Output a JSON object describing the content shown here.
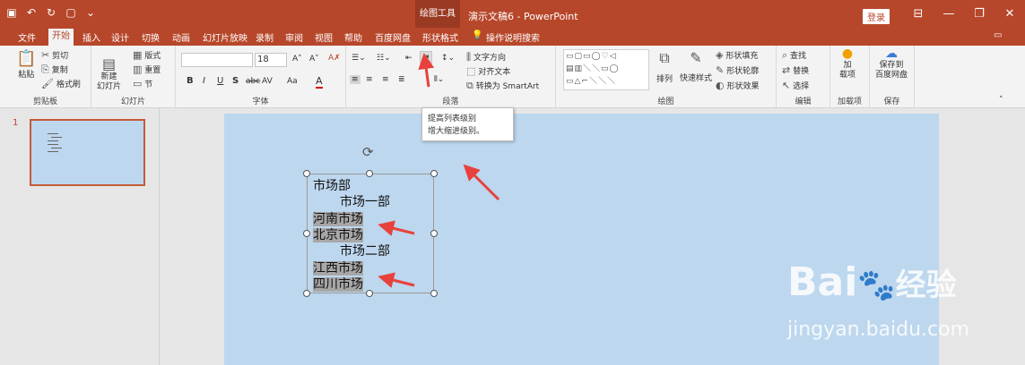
{
  "titlebar": {
    "qat_icons": [
      "save-icon",
      "undo-icon",
      "redo-icon",
      "new-icon",
      "customize-icon"
    ],
    "context_label": "绘图工具",
    "doc_title": "演示文稿6 - PowerPoint",
    "login": "登录",
    "window_buttons": [
      "⊟",
      "—",
      "❐",
      "✕"
    ]
  },
  "tabs": [
    "文件",
    "开始",
    "插入",
    "设计",
    "切换",
    "动画",
    "幻灯片放映",
    "录制",
    "审阅",
    "视图",
    "帮助",
    "百度网盘",
    "形状格式"
  ],
  "tell_me": "操作说明搜索",
  "ribbon": {
    "clipboard": {
      "paste": "粘贴",
      "cut": "剪切",
      "copy": "复制",
      "format_painter": "格式刷",
      "label": "剪贴板"
    },
    "slides": {
      "new_slide": "新建\n幻灯片",
      "layout": "版式",
      "reset": "重置",
      "section": "节",
      "label": "幻灯片"
    },
    "font": {
      "font_name": "",
      "font_size": "18",
      "label": "字体",
      "bold": "B",
      "italic": "I",
      "underline": "U",
      "shadow": "S",
      "strike": "abc",
      "spacing": "AV",
      "case": "Aa",
      "color": "A"
    },
    "paragraph": {
      "text_direction": "文字方向",
      "align_text": "对齐文本",
      "smartart": "转换为 SmartArt",
      "label": "段落"
    },
    "drawing": {
      "arrange": "排列",
      "quick_styles": "快速样式",
      "fill": "形状填充",
      "outline": "形状轮廓",
      "effects": "形状效果",
      "label": "绘图"
    },
    "editing": {
      "find": "查找",
      "replace": "替换",
      "select": "选择",
      "label": "编辑"
    },
    "addins": {
      "label_btn": "加\n载项",
      "label": "加载项"
    },
    "save": {
      "btn": "保存到\n百度网盘",
      "label": "保存"
    }
  },
  "tooltip": {
    "title": "提高列表级别",
    "desc": "增大缩进级别。"
  },
  "sidebar": {
    "slide_number": "1"
  },
  "slide": {
    "lines": [
      {
        "text": "市场部",
        "indent": 0,
        "selected": false
      },
      {
        "text": "市场一部",
        "indent": 1,
        "selected": false
      },
      {
        "text": "河南市场",
        "indent": 0,
        "selected": true
      },
      {
        "text": "北京市场",
        "indent": 0,
        "selected": true
      },
      {
        "text": "市场二部",
        "indent": 1,
        "selected": false
      },
      {
        "text": "江西市场",
        "indent": 0,
        "selected": true
      },
      {
        "text": "四川市场",
        "indent": 0,
        "selected": true
      }
    ]
  },
  "watermark": {
    "logo": "Bai",
    "logo2": "经验",
    "url": "jingyan.baidu.com"
  },
  "colors": {
    "accent": "#b7472a",
    "slide_bg": "#bdd7ee",
    "arrow": "#e8413c"
  }
}
